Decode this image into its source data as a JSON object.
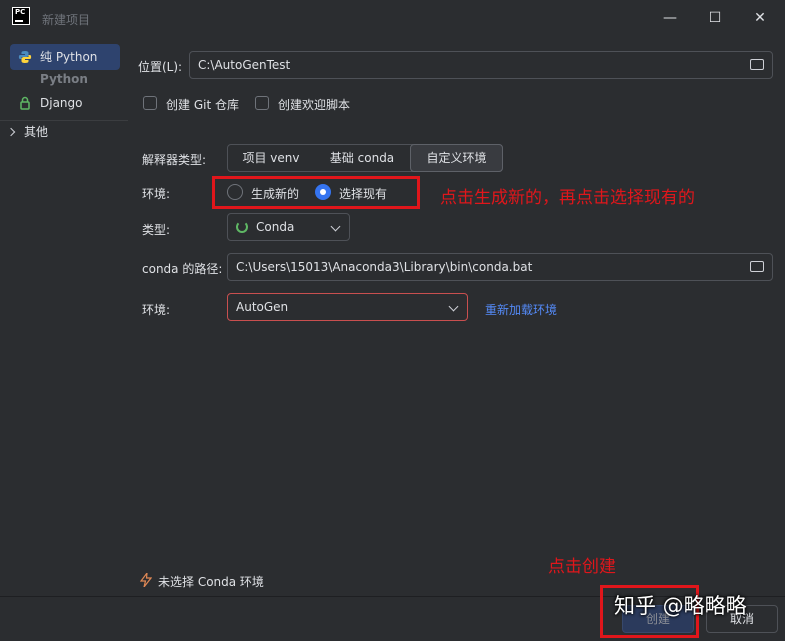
{
  "window": {
    "logo_text": "PC",
    "title": "新建项目",
    "minimize": "—",
    "maximize": "☐",
    "close": "✕"
  },
  "sidebar": {
    "items": [
      {
        "label": "纯 Python",
        "icon": "python-icon",
        "active": true
      },
      {
        "label": "Django",
        "icon": "django-icon",
        "active": false
      }
    ],
    "section_header": "Python",
    "group": {
      "label": "其他",
      "icon": "chevron-right-icon"
    }
  },
  "form": {
    "location_label": "位置(L):",
    "location_value": "C:\\AutoGenTest",
    "create_git_label": "创建 Git 仓库",
    "create_welcome_label": "创建欢迎脚本",
    "interpreter_type_label": "解释器类型:",
    "interpreter_types": [
      "项目 venv",
      "基础 conda",
      "自定义环境"
    ],
    "interpreter_selected": "自定义环境",
    "env_label": "环境:",
    "env_options": [
      "生成新的",
      "选择现有"
    ],
    "env_selected": "选择现有",
    "type_label": "类型:",
    "type_value": "Conda",
    "conda_path_label": "conda 的路径:",
    "conda_path_value": "C:\\Users\\15013\\Anaconda3\\Library\\bin\\conda.bat",
    "env2_label": "环境:",
    "env2_value": "AutoGen",
    "reload_env_link": "重新加载环境"
  },
  "status": {
    "warning_icon": "lightning-icon",
    "message": "未选择 Conda 环境"
  },
  "footer": {
    "create_button": "创建",
    "cancel_button": "取消"
  },
  "annotations": {
    "radio_hint": "点击生成新的，再点击选择现有的",
    "create_hint": "点击创建",
    "color": "#e0161b"
  },
  "watermark": "知乎 @略略略",
  "colors": {
    "accent": "#3574f0",
    "link": "#548af7",
    "selected_sidebar": "#2e436e",
    "error_border": "#c94f4f"
  }
}
